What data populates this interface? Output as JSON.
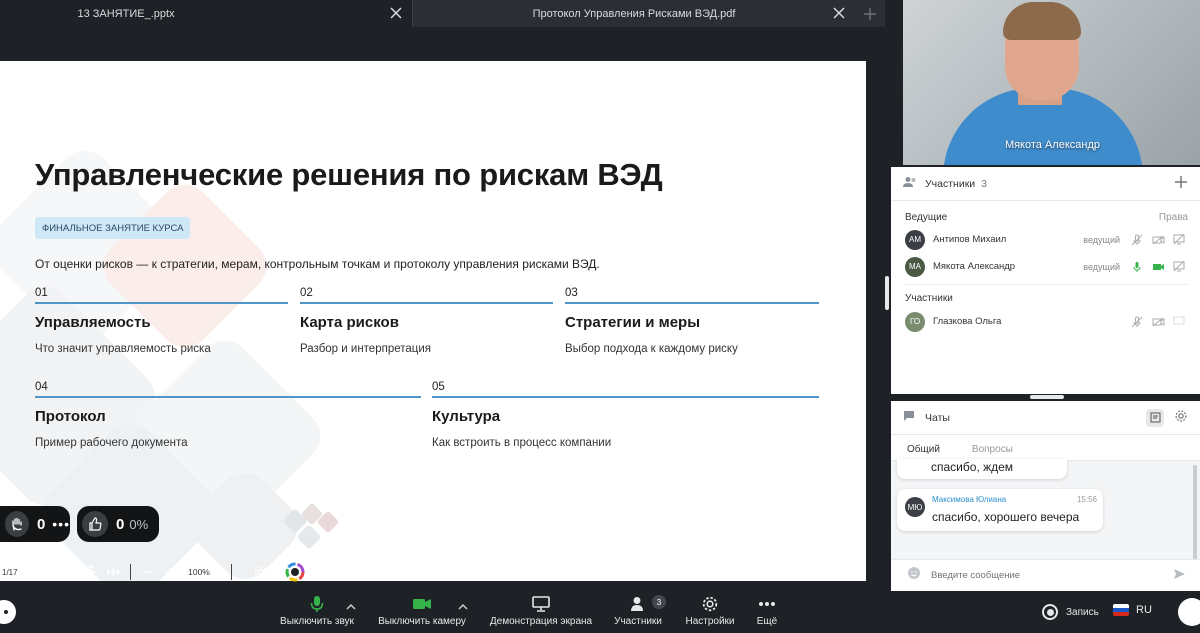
{
  "tabs": [
    {
      "label": "13 ЗАНЯТИЕ_.pptx"
    },
    {
      "label": "Протокол Управления Рисками ВЭД.pdf"
    }
  ],
  "slide": {
    "title": "Управленческие решения по рискам ВЭД",
    "badge": "ФИНАЛЬНОЕ ЗАНЯТИЕ КУРСА",
    "subtitle": "От оценки рисков — к стратегии, мерам, контрольным точкам и протоколу управления рисками ВЭД.",
    "items": [
      {
        "num": "01",
        "title": "Управляемость",
        "desc": "Что значит управляемость риска"
      },
      {
        "num": "02",
        "title": "Карта рисков",
        "desc": "Разбор и интерпретация"
      },
      {
        "num": "03",
        "title": "Стратегии и меры",
        "desc": "Выбор подхода к каждому риску"
      },
      {
        "num": "04",
        "title": "Протокол",
        "desc": "Пример рабочего документа"
      },
      {
        "num": "05",
        "title": "Культура",
        "desc": "Как встроить в процесс компании"
      }
    ]
  },
  "reactions": {
    "hands": "0",
    "more": "•••",
    "likes": "0",
    "like_pct": "0%"
  },
  "slide_toolbar": {
    "page": "1/17",
    "zoom": "100%"
  },
  "video": {
    "name": "Мякота Александр"
  },
  "participants": {
    "title": "Участники",
    "count": "3",
    "hosts_label": "Ведущие",
    "rights_label": "Права",
    "members_label": "Участники",
    "hosts": [
      {
        "initials": "АМ",
        "name": "Антипов Михаил",
        "role": "ведущий",
        "color": "#3b3f45"
      },
      {
        "initials": "МА",
        "name": "Мякота Александр",
        "role": "ведущий",
        "color": "#4a5a45"
      }
    ],
    "members": [
      {
        "initials": "ГО",
        "name": "Глазкова Ольга",
        "color": "#7a8c6e"
      }
    ]
  },
  "chat": {
    "title": "Чаты",
    "tabs": [
      "Общий",
      "Вопросы"
    ],
    "messages": [
      {
        "text": "спасибо, ждем"
      },
      {
        "initials": "МЮ",
        "author": "Максимова Юлиана",
        "time": "15:56",
        "text": "спасибо, хорошего вечера"
      }
    ],
    "input_placeholder": "Введите сообщение"
  },
  "bottom": {
    "mute": "Выключить звук",
    "camera": "Выключить камеру",
    "share": "Демонстрация экрана",
    "participants": "Участники",
    "participants_count": "3",
    "settings": "Настройки",
    "more": "Ещё",
    "record": "Запись",
    "lang": "RU"
  },
  "colors": {
    "accent_blue": "#4f96c6",
    "green": "#35b24a",
    "dark_bg": "#1e2125"
  }
}
